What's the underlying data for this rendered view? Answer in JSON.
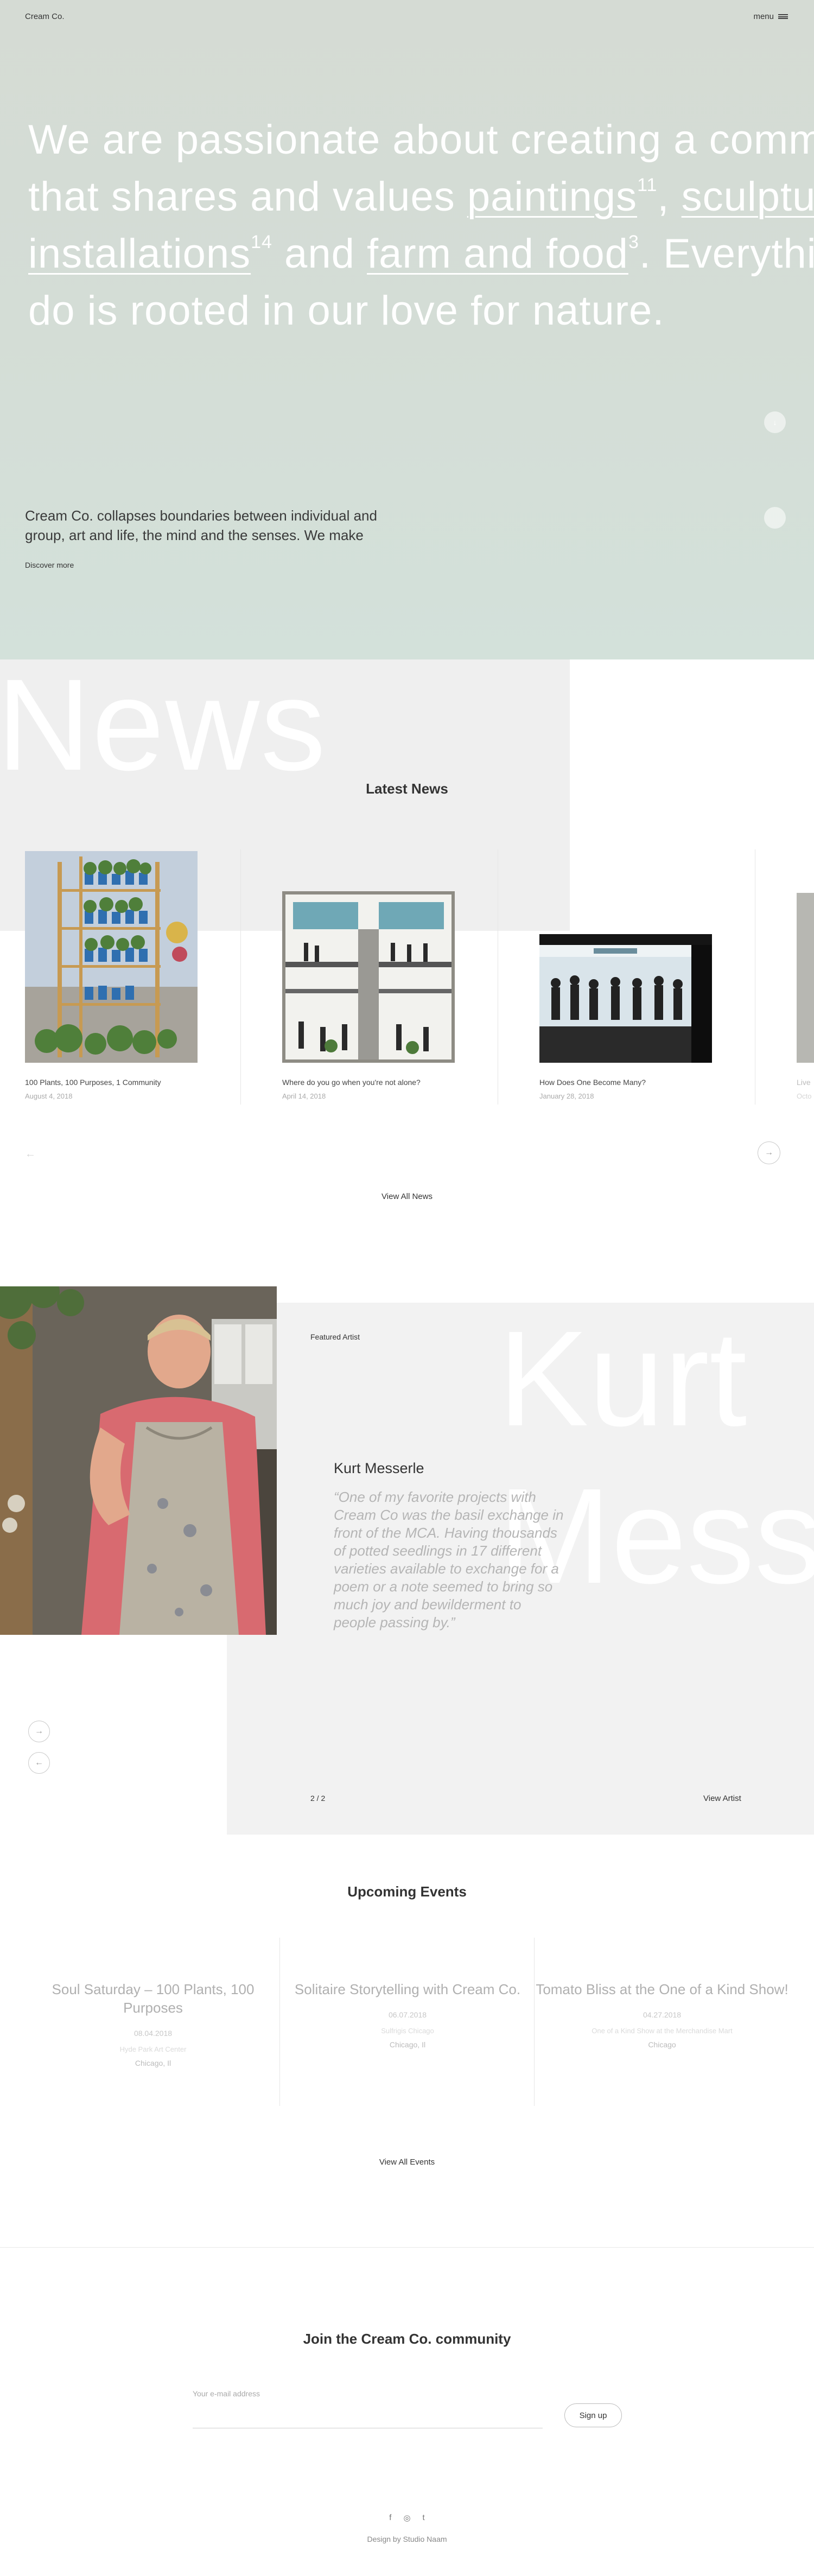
{
  "header": {
    "brand": "Cream Co.",
    "menu_label": "menu",
    "menu_icon": "hamburger-icon"
  },
  "hero": {
    "line1": "We are passionate about creating a commu",
    "line2_before": "that shares and values ",
    "paintings": "paintings",
    "paintings_count": "11",
    "comma1": ", ",
    "sculptures": "sculpture",
    "installations": "installations",
    "installations_count": "14",
    "and_text": " and ",
    "farm": "farm and food",
    "farm_count": "3",
    "line3_after": ". Everything",
    "line4": "do is rooted in our love for nature.",
    "description": "Cream Co. collapses boundaries between individual and group, art and life, the mind and the senses. We make",
    "discover": "Discover more",
    "down_icon": "arrow-down-icon",
    "scroll_icon": "dot-icon"
  },
  "news": {
    "bg_word": "News",
    "title": "Latest News",
    "items": [
      {
        "title": "100 Plants, 100 Purposes, 1 Community",
        "date": "August 4, 2018"
      },
      {
        "title": "Where do you go when you're not alone?",
        "date": "April 14, 2018"
      },
      {
        "title": "How Does One Become Many?",
        "date": "January 28, 2018"
      },
      {
        "title": "Live",
        "date": "Octo"
      }
    ],
    "prev_icon": "arrow-left-icon",
    "next_icon": "arrow-right-icon",
    "view_all": "View All News"
  },
  "artist": {
    "label": "Featured Artist",
    "bg_line1": "Kurt",
    "bg_line2": "Mess",
    "name": "Kurt Messerle",
    "quote": "“One of my favorite projects with Cream Co was the basil exchange in front of the MCA. Having thousands of potted seedlings in 17 different varieties available to exchange for a poem or a note seemed to bring so much joy and bewilderment to people passing by.”",
    "counter": "2 / 2",
    "view_artist": "View Artist"
  },
  "events": {
    "title": "Upcoming Events",
    "items": [
      {
        "title": "Soul Saturday – 100 Plants, 100 Purposes",
        "date": "08.04.2018",
        "venue": "Hyde Park Art Center",
        "city": "Chicago, Il"
      },
      {
        "title": "Solitaire Storytelling with Cream Co.",
        "date": "06.07.2018",
        "venue": "Sulfrigis Chicago",
        "city": "Chicago, Il"
      },
      {
        "title": "Tomato Bliss at the One of a Kind Show!",
        "date": "04.27.2018",
        "venue": "One of a Kind Show at the Merchandise Mart",
        "city": "Chicago"
      }
    ],
    "view_all": "View All Events"
  },
  "newsletter": {
    "title": "Join the Cream Co. community",
    "label": "Your e-mail address",
    "placeholder": "",
    "button": "Sign up"
  },
  "footer": {
    "social": [
      {
        "glyph": "f",
        "icon": "facebook-icon"
      },
      {
        "glyph": "◎",
        "icon": "instagram-icon"
      },
      {
        "glyph": "t",
        "icon": "tumblr-icon"
      }
    ],
    "credit": "Design by Studio Naam"
  }
}
